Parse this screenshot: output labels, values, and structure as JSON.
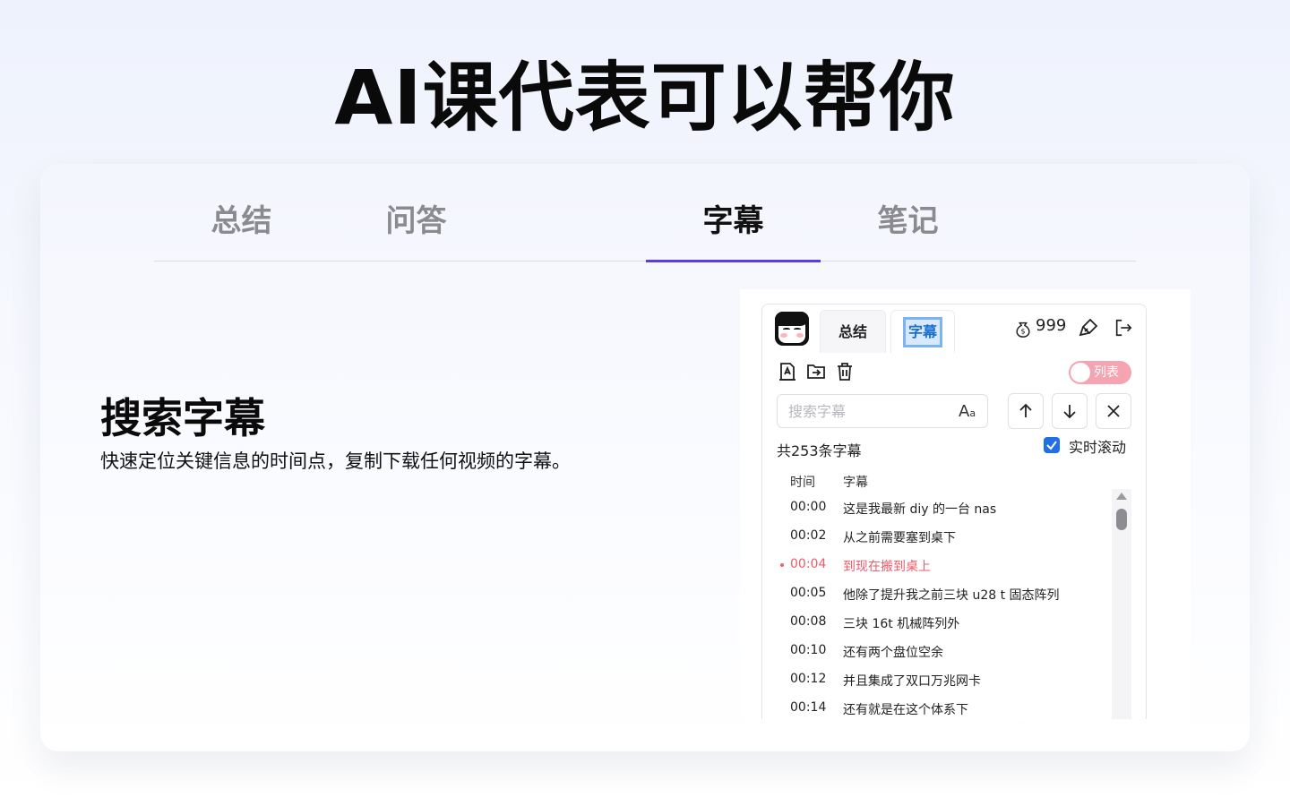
{
  "page": {
    "title": "AI课代表可以帮你"
  },
  "tabs": [
    {
      "label": "总结"
    },
    {
      "label": "问答"
    },
    {
      "label": "字幕"
    },
    {
      "label": "笔记"
    }
  ],
  "feature": {
    "title": "搜索字幕",
    "description": "快速定位关键信息的时间点，复制下载任何视频的字幕。"
  },
  "plugin": {
    "tabs": {
      "summary": "总结",
      "subtitles": "字幕"
    },
    "coins": "999",
    "toggle_label": "列表",
    "search_placeholder": "搜索字幕",
    "font_icon": {
      "big": "A",
      "small": "a"
    },
    "count_text": "共253条字幕",
    "live_scroll_label": "实时滚动",
    "columns": {
      "time": "时间",
      "subtitle": "字幕"
    },
    "rows": [
      {
        "time": "00:00",
        "text": "这是我最新 diy 的一台 nas"
      },
      {
        "time": "00:02",
        "text": "从之前需要塞到桌下"
      },
      {
        "time": "00:04",
        "text": "到现在搬到桌上"
      },
      {
        "time": "00:05",
        "text": "他除了提升我之前三块 u28 t 固态阵列"
      },
      {
        "time": "00:08",
        "text": "三块 16t 机械阵列外"
      },
      {
        "time": "00:10",
        "text": "还有两个盘位空余"
      },
      {
        "time": "00:12",
        "text": "并且集成了双口万兆网卡"
      },
      {
        "time": "00:14",
        "text": "还有就是在这个体系下"
      }
    ],
    "current_row_index": 2
  },
  "colors": {
    "accent": "#5b3de0",
    "highlight": "#f05a6a",
    "checkbox": "#1f6fe5",
    "toggle": "#f5a4b2"
  },
  "icons": [
    "coin-icon",
    "brush-icon",
    "logout-icon",
    "export-icon",
    "folder-icon",
    "trash-icon",
    "arrow-up-icon",
    "arrow-down-icon",
    "close-icon",
    "check-icon"
  ]
}
